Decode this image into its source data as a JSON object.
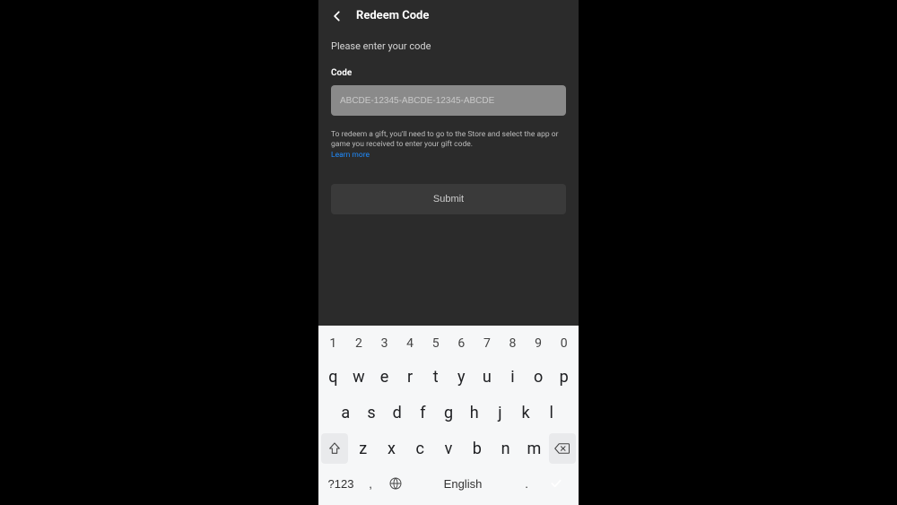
{
  "header": {
    "title": "Redeem Code"
  },
  "page": {
    "subtitle": "Please enter your code",
    "code_label": "Code",
    "code_placeholder": "ABCDE-12345-ABCDE-12345-ABCDE",
    "help_text": "To redeem a gift, you'll need to go to the Store and select the app or game you received to enter your gift code.",
    "learn_more": "Learn more",
    "submit_label": "Submit"
  },
  "keyboard": {
    "row_num": [
      "1",
      "2",
      "3",
      "4",
      "5",
      "6",
      "7",
      "8",
      "9",
      "0"
    ],
    "row_top": [
      "q",
      "w",
      "e",
      "r",
      "t",
      "y",
      "u",
      "i",
      "o",
      "p"
    ],
    "row_mid": [
      "a",
      "s",
      "d",
      "f",
      "g",
      "h",
      "j",
      "k",
      "l"
    ],
    "row_bot": [
      "z",
      "x",
      "c",
      "v",
      "b",
      "n",
      "m"
    ],
    "sym": "?123",
    "comma": ",",
    "period": ".",
    "space_label": "English"
  }
}
